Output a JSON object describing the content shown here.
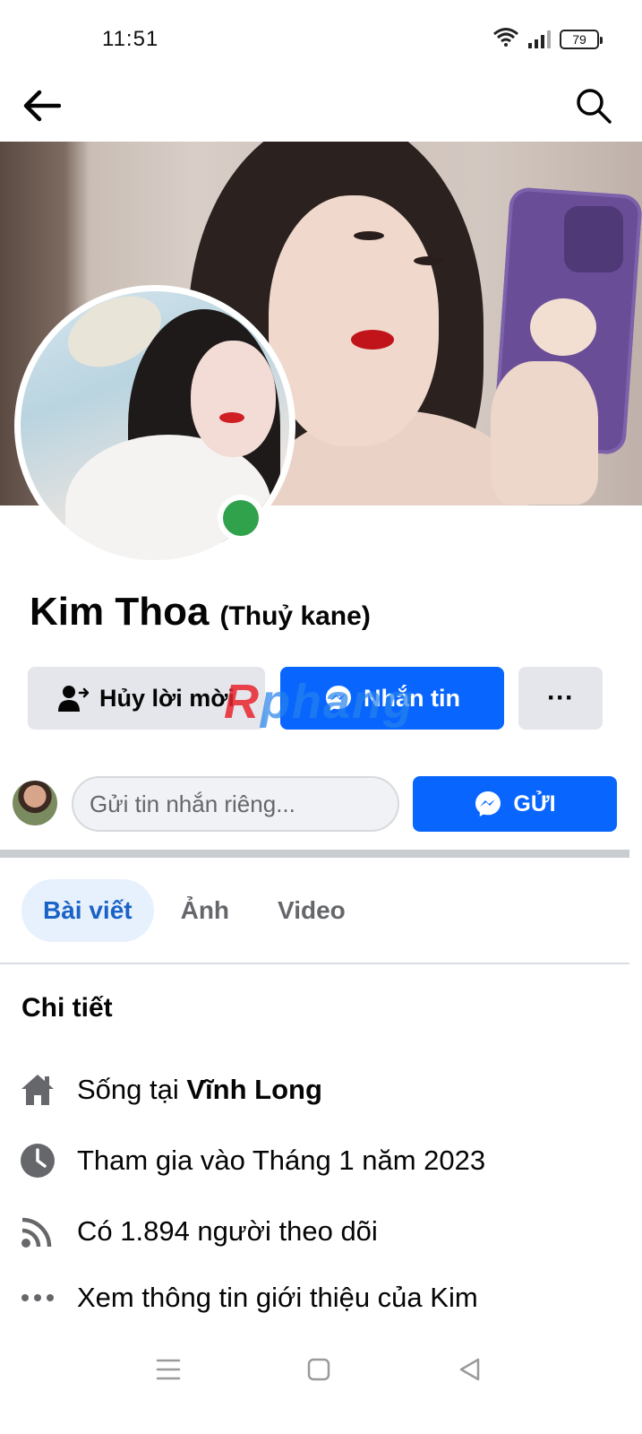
{
  "status_bar": {
    "time": "11:51",
    "battery": "79",
    "icons": [
      "wifi-icon",
      "signal-icon",
      "battery-icon"
    ]
  },
  "top_nav": {
    "back_icon": "arrow-left-icon",
    "search_icon": "search-icon"
  },
  "profile": {
    "name": "Kim Thoa",
    "alternate_name": "(Thuỷ kane)",
    "online": true,
    "online_color": "#31a24c"
  },
  "actions": {
    "cancel_request_label": "Hủy lời mời",
    "message_label": "Nhắn tin",
    "more_label": "···"
  },
  "watermark": {
    "first_letter": "R",
    "rest": "phang"
  },
  "compose": {
    "placeholder": "Gửi tin nhắn riêng...",
    "send_label": "GỬI"
  },
  "tabs": [
    {
      "label": "Bài viết",
      "active": true
    },
    {
      "label": "Ảnh",
      "active": false
    },
    {
      "label": "Video",
      "active": false
    }
  ],
  "details": {
    "title": "Chi tiết",
    "lives_prefix": "Sống tại ",
    "lives_place": "Vĩnh Long",
    "joined": "Tham gia vào Tháng 1 năm 2023",
    "followers": "Có 1.894 người theo dõi",
    "see_about": "Xem thông tin giới thiệu của Kim"
  },
  "system_nav": {
    "icons": [
      "menu-icon",
      "home-square-icon",
      "back-triangle-icon"
    ]
  },
  "colors": {
    "primary_blue": "#0866ff",
    "tab_active_bg": "#e7f0fd",
    "tab_active_text": "#1a63c6",
    "button_gray": "#e4e6eb"
  }
}
